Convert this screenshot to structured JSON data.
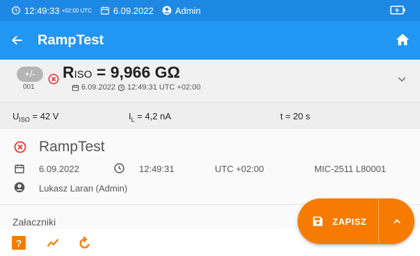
{
  "status_bar": {
    "time": "12:49:33",
    "tz": "+02:00 UTC",
    "date": "6.09.2022",
    "user": "Admin"
  },
  "app_bar": {
    "title": "RampTest"
  },
  "result": {
    "pm_label": "+/-",
    "index": "001",
    "value": "9,966 GΩ",
    "meta_date": "6.09.2022",
    "meta_time": "12:49:31 UTC +02:00"
  },
  "params": {
    "uiso": "= 42 V",
    "il": "= 4,2 nA",
    "t": "t = 20 s"
  },
  "info": {
    "title": "RampTest",
    "date": "6.09.2022",
    "time": "12:49:31",
    "tz": "UTC +02:00",
    "device": "MIC-2511 L80001",
    "user": "Lukasz Laran (Admin)"
  },
  "attachments_label": "Załaczniki",
  "save_button": {
    "label": "ZAPISZ"
  },
  "colors": {
    "primary": "#2196f3",
    "status": "#1e88e5",
    "accent": "#f57c00",
    "fail": "#e53935"
  }
}
